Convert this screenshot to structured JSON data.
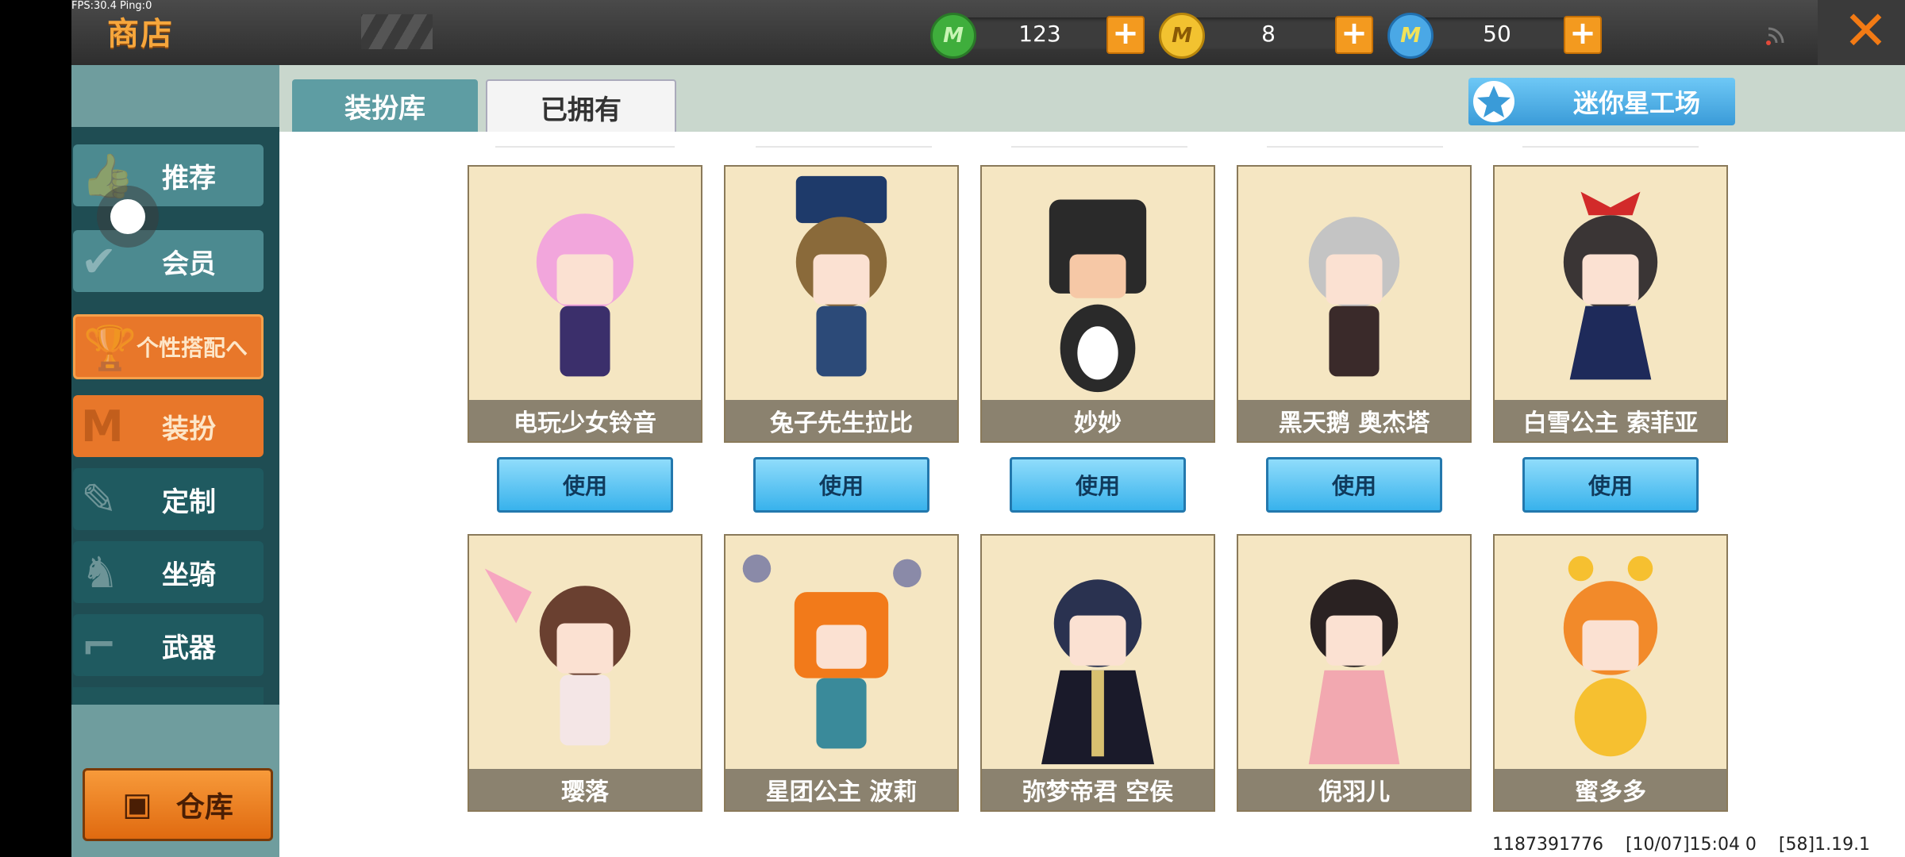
{
  "debug": {
    "fps": "FPS:30.4  Ping:0"
  },
  "header": {
    "title": "商店",
    "currencies": [
      {
        "icon": "green-gem-icon",
        "letter": "M",
        "value": "123",
        "color": "#3fae3c"
      },
      {
        "icon": "gold-coin-icon",
        "letter": "M",
        "value": "8",
        "color": "#f2c230"
      },
      {
        "icon": "blue-coin-icon",
        "letter": "M",
        "value": "50",
        "color": "#4aa8e6"
      }
    ],
    "close_label": "✕"
  },
  "sidebar": {
    "items": [
      {
        "label": "推荐",
        "icon": "thumbs-up-icon"
      },
      {
        "label": "会员",
        "icon": "member-icon"
      },
      {
        "label": "个性搭配へ",
        "icon": "trophy-icon"
      },
      {
        "label": "装扮",
        "icon": "shirt-icon"
      },
      {
        "label": "定制",
        "icon": "pencil-icon"
      },
      {
        "label": "坐骑",
        "icon": "mount-icon"
      },
      {
        "label": "武器",
        "icon": "gun-icon"
      }
    ],
    "warehouse_label": "仓库"
  },
  "tabs": {
    "wardrobe": "装扮库",
    "owned": "已拥有"
  },
  "workshop_label": "迷你星工场",
  "items_row1": [
    {
      "name": "电玩少女铃音",
      "use": "使用",
      "hair": "#f2a6dc",
      "outfit": "#3b2f6b"
    },
    {
      "name": "兔子先生拉比",
      "use": "使用",
      "hair": "#8a6a3a",
      "outfit": "#2c4a78"
    },
    {
      "name": "妙妙",
      "use": "使用",
      "hair": "#2a2a2a",
      "outfit": "#2a2a2a"
    },
    {
      "name": "黑天鹅 奥杰塔",
      "use": "使用",
      "hair": "#c4c4c4",
      "outfit": "#3a2a2a"
    },
    {
      "name": "白雪公主 索菲亚",
      "use": "使用",
      "hair": "#3a3535",
      "outfit": "#1e2a5a"
    }
  ],
  "items_row2": [
    {
      "name": "璎落",
      "hair": "#6a4030",
      "outfit": "#f4e6e6"
    },
    {
      "name": "星团公主 波莉",
      "hair": "#f27a1a",
      "outfit": "#3a8a9a"
    },
    {
      "name": "弥梦帝君 空侯",
      "hair": "#2a3250",
      "outfit": "#1a1a2a"
    },
    {
      "name": "倪羽儿",
      "hair": "#2a2222",
      "outfit": "#f2a8b0"
    },
    {
      "name": "蜜多多",
      "hair": "#f28a2a",
      "outfit": "#f6c030"
    }
  ],
  "footer": {
    "user_id": "1187391776",
    "timestamp": "[10/07]15:04 0",
    "version": "[58]1.19.1"
  }
}
